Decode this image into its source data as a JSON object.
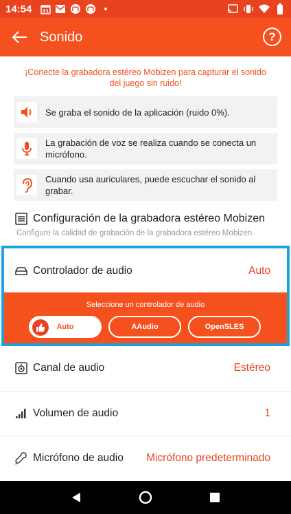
{
  "status_bar": {
    "time": "14:54",
    "calendar_day": "31"
  },
  "app_bar": {
    "title": "Sonido",
    "help_label": "?"
  },
  "notice": "¡Conecte la grabadora estéreo Mobizen para capturar el sonido del juego sin ruido!",
  "info_cards": [
    {
      "icon": "speaker-icon",
      "text": "Se graba el sonido de la aplicación (ruido 0%)."
    },
    {
      "icon": "microphone-icon",
      "text": "La grabación de voz se realiza cuando se conecta un micrófono."
    },
    {
      "icon": "ear-icon",
      "text": "Cuando usa auriculares, puede escuchar el sonido al grabar."
    }
  ],
  "config": {
    "title": "Configuración de la grabadora estéreo Mobizen",
    "subtitle": "Configure la calidad de grabación de la grabadora estéreo Mobizen."
  },
  "audio_driver": {
    "label": "Controlador de audio",
    "value": "Auto",
    "panel_label": "Seleccione un controlador de audio",
    "options": [
      "Auto",
      "AAudio",
      "OpenSLES"
    ],
    "selected": "Auto"
  },
  "settings": [
    {
      "icon": "speaker-box-icon",
      "label": "Canal de audio",
      "value": "Estéreo"
    },
    {
      "icon": "signal-bars-icon",
      "label": "Volumen de audio",
      "value": "1"
    },
    {
      "icon": "microphone-outline-icon",
      "label": "Micrófono de audio",
      "value": "Micrófono predeterminado"
    }
  ],
  "colors": {
    "accent": "#f4511e",
    "status_bar": "#e8431e",
    "highlight": "#1aa3e0"
  }
}
